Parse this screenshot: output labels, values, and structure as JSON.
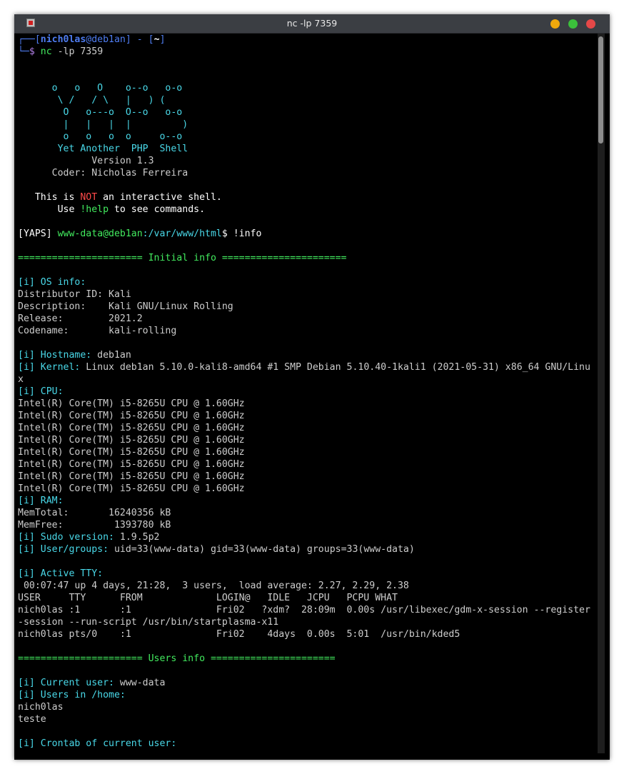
{
  "window": {
    "title": "nc -lp 7359"
  },
  "colors": {
    "titlebar": "#3b3e43",
    "background": "#000000",
    "cyan": "#49d8e8",
    "green": "#42ea5e",
    "red": "#ff4a4a",
    "blue": "#4e7cf0",
    "text": "#cdcdcd"
  },
  "prompt": {
    "line1_pre": "┌──[",
    "user": "nich0las",
    "at_host": "@deb1an",
    "close_bracket": "]",
    "dash": " - ",
    "dir_open": "[",
    "dir": "~",
    "dir_close": "]",
    "line2_pre": "└─",
    "dollar": "$ ",
    "cmd": "nc",
    "cmd_args": " -lp 7359"
  },
  "banner": {
    "art": [
      "      o   o   O    o--o   o-o",
      "       \\ /   / \\   |   ) (",
      "        O   o---o  O--o   o-o",
      "        |   |   |  |         )",
      "        o   o   o  o     o--o"
    ],
    "title": "       Yet Another  PHP  Shell",
    "version": "             Version 1.3",
    "coder": "      Coder: Nicholas Ferreira",
    "notice_pre": "   This is ",
    "notice_not": "NOT",
    "notice_post": " an interactive shell.",
    "help_pre": "       Use ",
    "help_cmd": "!help",
    "help_post": " to see commands."
  },
  "yaps_prompt": {
    "tag": "[YAPS] ",
    "user": "www-data@deb1an",
    "path": ":/var/www/html",
    "dollar": "$ ",
    "cmd": "!info"
  },
  "initial_info": {
    "header": "====================== Initial info ======================",
    "os_label": "[i] OS info:",
    "os_lines": [
      "Distributor ID: Kali",
      "Description:    Kali GNU/Linux Rolling",
      "Release:        2021.2",
      "Codename:       kali-rolling"
    ],
    "hostname_label": "[i] Hostname:",
    "hostname": " deb1an",
    "kernel_label": "[i] Kernel:",
    "kernel": " Linux deb1an 5.10.0-kali8-amd64 #1 SMP Debian 5.10.40-1kali1 (2021-05-31) x86_64 GNU/Linu",
    "kernel_wrap": "x",
    "cpu_label": "[i] CPU:",
    "cpu_lines": [
      "Intel(R) Core(TM) i5-8265U CPU @ 1.60GHz",
      "Intel(R) Core(TM) i5-8265U CPU @ 1.60GHz",
      "Intel(R) Core(TM) i5-8265U CPU @ 1.60GHz",
      "Intel(R) Core(TM) i5-8265U CPU @ 1.60GHz",
      "Intel(R) Core(TM) i5-8265U CPU @ 1.60GHz",
      "Intel(R) Core(TM) i5-8265U CPU @ 1.60GHz",
      "Intel(R) Core(TM) i5-8265U CPU @ 1.60GHz",
      "Intel(R) Core(TM) i5-8265U CPU @ 1.60GHz"
    ],
    "ram_label": "[i] RAM:",
    "ram_lines": [
      "MemTotal:       16240356 kB",
      "MemFree:         1393780 kB"
    ],
    "sudo_label": "[i] Sudo version:",
    "sudo": " 1.9.5p2",
    "groups_label": "[i] User/groups:",
    "groups": " uid=33(www-data) gid=33(www-data) groups=33(www-data)",
    "tty_label": "[i] Active TTY:",
    "tty_lines": [
      " 00:07:47 up 4 days, 21:28,  3 users,  load average: 2.27, 2.29, 2.38",
      "USER     TTY      FROM             LOGIN@   IDLE   JCPU   PCPU WHAT",
      "nich0las :1       :1               Fri02   ?xdm?  28:09m  0.00s /usr/libexec/gdm-x-session --register",
      "-session --run-script /usr/bin/startplasma-x11",
      "nich0las pts/0    :1               Fri02    4days  0.00s  5:01  /usr/bin/kded5"
    ]
  },
  "users_info": {
    "header": "====================== Users info ======================",
    "current_label": "[i] Current user:",
    "current": " www-data",
    "home_label": "[i] Users in /home:",
    "home_users": [
      "nich0las",
      "teste"
    ],
    "crontab_label": "[i] Crontab of current user:"
  }
}
